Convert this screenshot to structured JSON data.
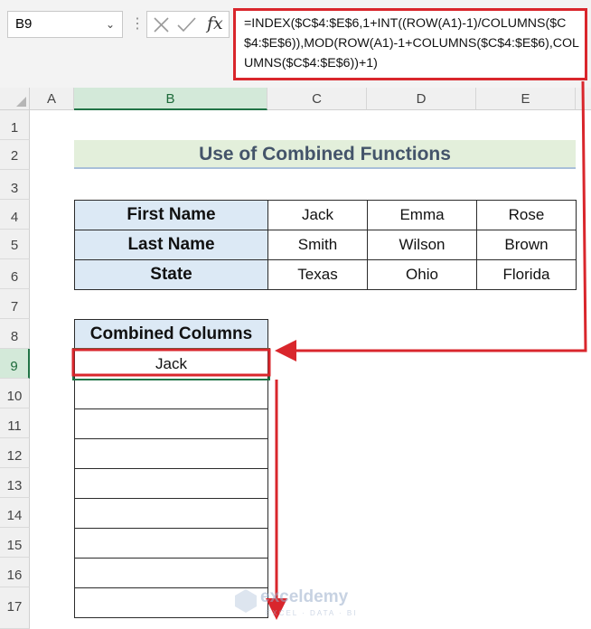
{
  "name_box": {
    "value": "B9"
  },
  "formula_bar": {
    "fx_label": "fx",
    "formula": "=INDEX($C$4:$E$6,1+INT((ROW(A1)-1)/COLUMNS($C$4:$E$6)),MOD(ROW(A1)-1+COLUMNS($C$4:$E$6),COLUMNS($C$4:$E$6))+1)"
  },
  "columns": [
    "A",
    "B",
    "C",
    "D",
    "E"
  ],
  "rows": [
    "1",
    "2",
    "3",
    "4",
    "5",
    "6",
    "7",
    "8",
    "9",
    "10",
    "11",
    "12",
    "13",
    "14",
    "15",
    "16",
    "17"
  ],
  "selected_cell": "B9",
  "sheet": {
    "title": "Use of Combined Functions",
    "table": [
      {
        "header": "First Name",
        "values": [
          "Jack",
          "Emma",
          "Rose"
        ]
      },
      {
        "header": "Last Name",
        "values": [
          "Smith",
          "Wilson",
          "Brown"
        ]
      },
      {
        "header": "State",
        "values": [
          "Texas",
          "Ohio",
          "Florida"
        ]
      }
    ],
    "combined_header": "Combined Columns",
    "combined_values": [
      "Jack",
      "",
      "",
      "",
      "",
      "",
      "",
      "",
      ""
    ]
  },
  "watermark": {
    "name": "exceldemy",
    "tagline": "EXCEL · DATA · BI"
  },
  "colors": {
    "highlight_red": "#d9262c",
    "excel_green": "#217346",
    "title_bg": "#e3efdb",
    "header_bg": "#dce9f5"
  }
}
